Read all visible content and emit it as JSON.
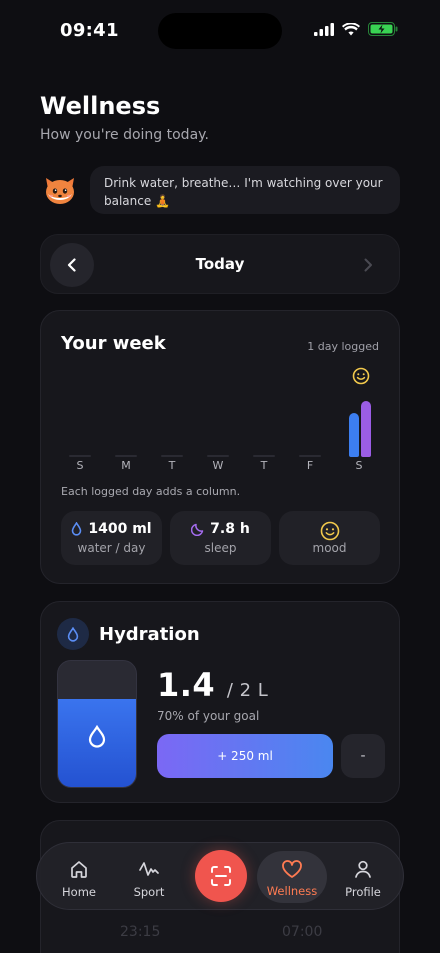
{
  "status": {
    "time": "09:41"
  },
  "header": {
    "title": "Wellness",
    "subtitle": "How you're doing today."
  },
  "mascot": {
    "message_line1": "Drink water, breathe… I'm watching over your",
    "message_line2": "balance 🧘"
  },
  "day_nav": {
    "label": "Today"
  },
  "week": {
    "title": "Your week",
    "logged": "1 day logged",
    "days": [
      "S",
      "M",
      "T",
      "W",
      "T",
      "F",
      "S"
    ],
    "hint": "Each logged day adds a column.",
    "stats": {
      "water_value": "1400 ml",
      "water_label": "water / day",
      "sleep_value": "7.8 h",
      "sleep_label": "sleep",
      "mood_label": "mood"
    },
    "colors": {
      "water_bar": "#3c7ef0",
      "sleep_bar": "#9b5de5",
      "mood": "#f2c94c"
    }
  },
  "hydration": {
    "title": "Hydration",
    "amount": "1.4",
    "goal": "/ 2 L",
    "progress_text": "70% of your goal",
    "progress_fraction": 0.7,
    "add_label": "+ 250 ml",
    "minus_label": "-"
  },
  "sleep_preview": {
    "start": "23:15",
    "end": "07:00"
  },
  "tabbar": {
    "home": "Home",
    "sport": "Sport",
    "wellness": "Wellness",
    "profile": "Profile",
    "active": "wellness",
    "accent": "#ff7b52",
    "scan_color": "#f0554e"
  }
}
